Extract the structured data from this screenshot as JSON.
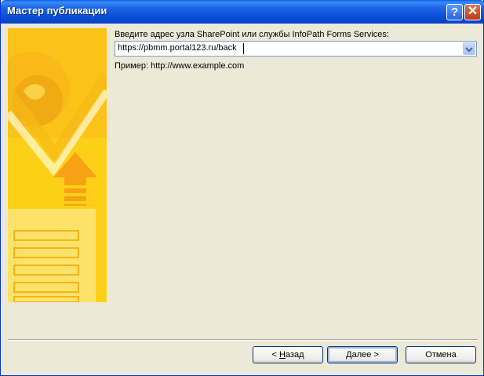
{
  "window": {
    "title": "Мастер публикации"
  },
  "controls": {
    "help_glyph": "?",
    "close_glyph": "✕"
  },
  "form": {
    "address_label": "Введите адрес узла SharePoint или службы InfoPath Forms Services:",
    "address_value": "https://pbmm.portal123.ru/back",
    "example_text": "Пример: http://www.example.com"
  },
  "buttons": {
    "back_prefix": "< ",
    "back_accel": "Н",
    "back_rest": "азад",
    "next_accel": "Д",
    "next_rest": "алее >",
    "cancel": "Отмена"
  },
  "icons": {
    "help": "help-icon",
    "close": "close-icon",
    "dropdown": "chevron-down-icon"
  },
  "colors": {
    "title_bar": "#0a4fd6",
    "art_yellow": "#fdd017",
    "window_bg": "#ece9d8"
  }
}
